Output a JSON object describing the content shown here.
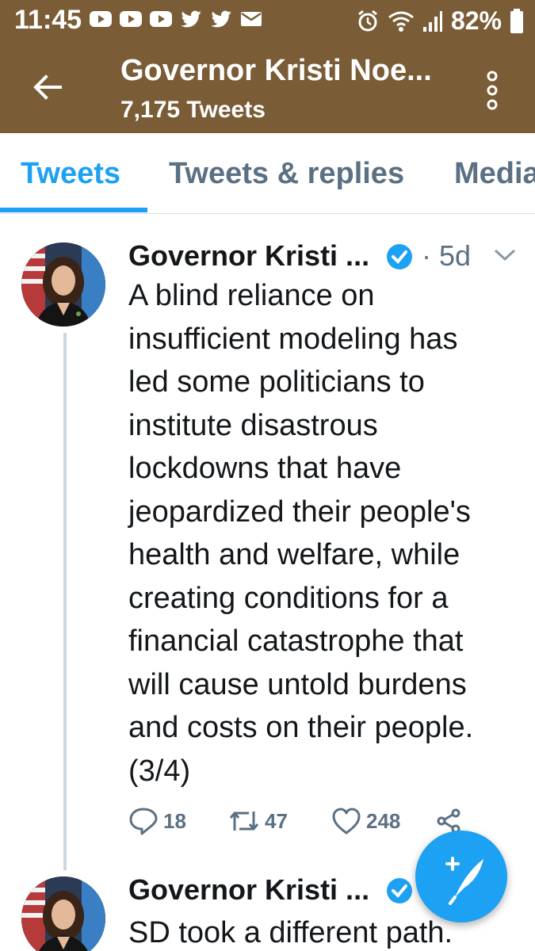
{
  "status_bar": {
    "time": "11:45",
    "battery": "82%",
    "icons": [
      "youtube-icon",
      "youtube-icon",
      "youtube-icon",
      "twitter-icon",
      "twitter-icon",
      "mail-icon",
      "alarm-icon",
      "wifi-icon",
      "signal-icon",
      "battery-icon"
    ]
  },
  "header": {
    "title": "Governor Kristi Noe...",
    "subtitle": "7,175 Tweets",
    "background": "#7a5c36"
  },
  "tabs": [
    {
      "label": "Tweets",
      "active": true
    },
    {
      "label": "Tweets & replies",
      "active": false
    },
    {
      "label": "Media",
      "active": false
    }
  ],
  "tweets": [
    {
      "name": "Governor Kristi ...",
      "time": "· 5d",
      "text": "A blind reliance on\ninsufficient modeling has\nled some politicians to\ninstitute disastrous\nlockdowns that have\njeopardized their people's\nhealth and welfare, while\ncreating conditions for a\nfinancial catastrophe that\nwill cause untold burdens\nand costs on their people.\n(3/4)",
      "replies": "18",
      "retweets": "47",
      "likes": "248"
    },
    {
      "name": "Governor Kristi ...",
      "text": "SD took a different path."
    }
  ],
  "colors": {
    "accent": "#1da1f2",
    "muted": "#5b7083",
    "text": "#14171a"
  }
}
